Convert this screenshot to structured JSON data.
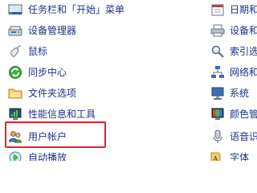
{
  "left_items": [
    {
      "label": "任务栏和「开始」菜单",
      "icon": "taskbar-icon"
    },
    {
      "label": "设备管理器",
      "icon": "device-manager-icon"
    },
    {
      "label": "鼠标",
      "icon": "mouse-icon"
    },
    {
      "label": "同步中心",
      "icon": "sync-center-icon"
    },
    {
      "label": "文件夹选项",
      "icon": "folder-options-icon"
    },
    {
      "label": "性能信息和工具",
      "icon": "performance-icon"
    },
    {
      "label": "用户帐户",
      "icon": "user-accounts-icon"
    },
    {
      "label": "自动播放",
      "icon": "autoplay-icon"
    }
  ],
  "right_items": [
    {
      "label": "日期和",
      "icon": "date-time-icon"
    },
    {
      "label": "设备和",
      "icon": "devices-printers-icon"
    },
    {
      "label": "索引选",
      "icon": "indexing-icon"
    },
    {
      "label": "网络和",
      "icon": "network-icon"
    },
    {
      "label": "系统",
      "icon": "system-icon"
    },
    {
      "label": "颜色管",
      "icon": "color-management-icon"
    },
    {
      "label": "语音识",
      "icon": "speech-icon"
    },
    {
      "label": "字体",
      "icon": "fonts-icon"
    }
  ],
  "highlight": {
    "target": "用户帐户",
    "color": "#e8202a"
  }
}
